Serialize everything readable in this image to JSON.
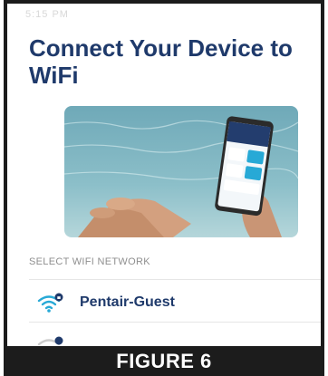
{
  "header": {
    "status_text": "5:15 PM",
    "title": "Connect Your Device to WiFi"
  },
  "networks_section": {
    "label": "SELECT WIFI NETWORK"
  },
  "networks": [
    {
      "name": "Pentair-Guest",
      "secure": true
    },
    {
      "name": "",
      "secure": true
    }
  ],
  "figure": {
    "caption": "FIGURE 6"
  },
  "colors": {
    "accent": "#1f3a6b",
    "wifi": "#27a9d6",
    "caption_bg": "#1c1c1c"
  },
  "icons": {
    "wifi": "wifi-lock-icon",
    "chevron": "chevron-right-icon"
  }
}
